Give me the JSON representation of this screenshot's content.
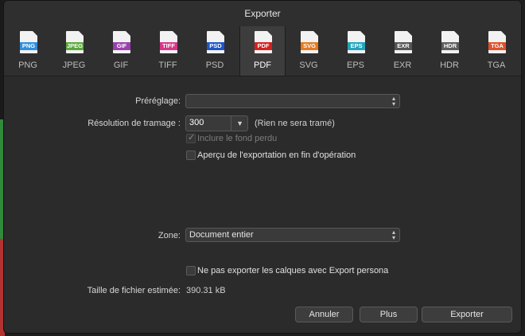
{
  "window": {
    "title": "Exporter"
  },
  "formats": [
    {
      "label": "PNG",
      "badge": "PNG",
      "color": "#2f8fdc"
    },
    {
      "label": "JPEG",
      "badge": "JPEG",
      "color": "#5aa83a"
    },
    {
      "label": "GIF",
      "badge": "GIF",
      "color": "#9b3fb0"
    },
    {
      "label": "TIFF",
      "badge": "TIFF",
      "color": "#d8358a"
    },
    {
      "label": "PSD",
      "badge": "PSD",
      "color": "#1e56c8"
    },
    {
      "label": "PDF",
      "badge": "PDF",
      "color": "#d42121"
    },
    {
      "label": "SVG",
      "badge": "SVG",
      "color": "#e57a1f"
    },
    {
      "label": "EPS",
      "badge": "EPS",
      "color": "#1ea6bd"
    },
    {
      "label": "EXR",
      "badge": "EXR",
      "color": "#555555"
    },
    {
      "label": "HDR",
      "badge": "HDR",
      "color": "#5c5c5c"
    },
    {
      "label": "TGA",
      "badge": "TGA",
      "color": "#e0502a"
    }
  ],
  "selected_format": "PDF",
  "form": {
    "preset_label": "Préréglage:",
    "preset_value": "",
    "raster_label": "Résolution de tramage :",
    "raster_value": "300",
    "raster_note": "(Rien ne sera tramé)",
    "bleed_label": "Inclure le fond perdu",
    "bleed_checked": true,
    "preview_label": "Aperçu de l'exportation en fin d'opération",
    "preview_checked": false,
    "zone_label": "Zone:",
    "zone_value": "Document entier",
    "layers_label": "Ne pas exporter les calques avec Export persona",
    "layers_checked": false,
    "filesize_label": "Taille de fichier estimée:",
    "filesize_value": "390.31 kB"
  },
  "buttons": {
    "cancel": "Annuler",
    "more": "Plus",
    "export": "Exporter"
  }
}
